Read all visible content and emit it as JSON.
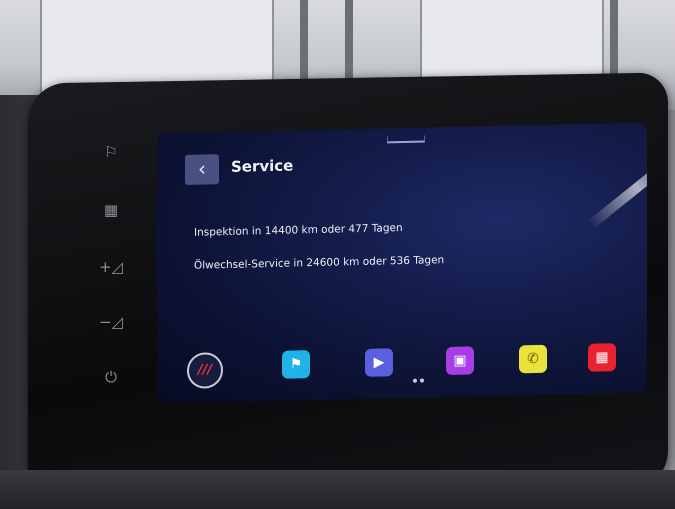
{
  "header": {
    "back_icon": "chevron-left-icon",
    "title": "Service"
  },
  "service_info": {
    "inspection": "Inspektion in 14400 km oder 477 Tagen",
    "oil_change": "Ölwechsel-Service in 24600 km oder 536 Tagen"
  },
  "side_keys": [
    {
      "name": "flag-icon",
      "glyph": "⚐"
    },
    {
      "name": "keyboard-icon",
      "glyph": "▦"
    },
    {
      "name": "volume-up-icon",
      "glyph": "+◿"
    },
    {
      "name": "volume-down-icon",
      "glyph": "−◿"
    },
    {
      "name": "power-icon",
      "glyph": "⏻"
    }
  ],
  "dock": {
    "home_label": "///",
    "apps": [
      {
        "name": "navigation-app-icon",
        "glyph": "⚑",
        "color": "#1fb3e8"
      },
      {
        "name": "media-app-icon",
        "glyph": "▶",
        "color": "#5b5fe0"
      },
      {
        "name": "vehicle-app-icon",
        "glyph": "▣",
        "color": "#a83ee6"
      },
      {
        "name": "phone-app-icon",
        "glyph": "✆",
        "color": "#e8e23a"
      },
      {
        "name": "apps-grid-icon",
        "glyph": "▦",
        "color": "#e8222e"
      }
    ],
    "page_indicator": {
      "pages": 2,
      "current": 1
    }
  }
}
